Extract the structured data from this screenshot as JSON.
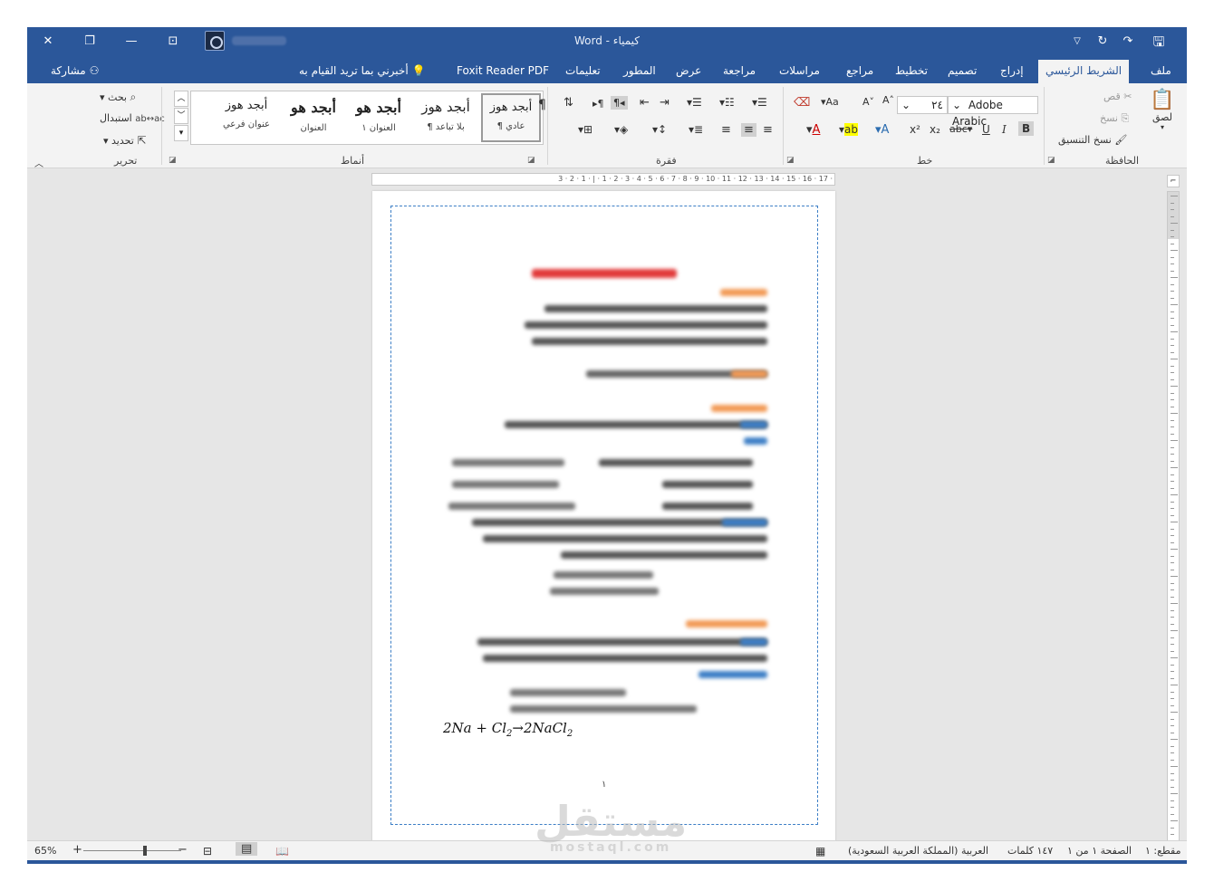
{
  "titlebar": {
    "title": "كيمياء  -  Word",
    "close_icon": "close-icon",
    "restore_icon": "restore-icon",
    "minimize_icon": "minimize-icon",
    "ribbon_display_icon": "ribbon-display-icon",
    "save_icon": "save-icon",
    "undo_icon": "undo-icon",
    "redo_icon": "redo-icon",
    "customize_icon": "customize-qat-icon"
  },
  "tabs": {
    "file": "ملف",
    "home": "الشريط الرئيسي",
    "insert": "إدراج",
    "design": "تصميم",
    "layout": "تخطيط",
    "references": "مراجع",
    "mailings": "مراسلات",
    "review": "مراجعة",
    "view": "عرض",
    "developer": "المطور",
    "help": "تعليمات",
    "foxit": "Foxit Reader PDF",
    "tell_me": "أخبرني بما تريد القيام به",
    "share": "مشاركة"
  },
  "clipboard": {
    "paste": "لصق",
    "cut": "قص",
    "copy": "نسخ",
    "format_painter": "نسخ التنسيق",
    "group": "الحافظة"
  },
  "font": {
    "name": "Adobe Arabic",
    "size": "٢٤",
    "group": "خط",
    "aa": "Aa"
  },
  "paragraph": {
    "group": "فقرة"
  },
  "styles": {
    "group": "أنماط",
    "items": [
      {
        "preview": "أبجد هوز",
        "name": "¶ عادي"
      },
      {
        "preview": "أبجد هوز",
        "name": "¶ بلا تباعد"
      },
      {
        "preview": "أبجد هو",
        "name": "العنوان ١"
      },
      {
        "preview": "أبجد هو",
        "name": "العنوان"
      },
      {
        "preview": "أبجد هوز",
        "name": "عنوان فرعي"
      }
    ]
  },
  "editing": {
    "group": "تحرير",
    "find": "بحث",
    "replace": "استبدال",
    "select": "تحديد"
  },
  "ruler": {
    "numbers": "3 · 2 · 1 · | · 1 · 2 · 3 · 4 · 5 · 6 · 7 · 8 · 9 · 10 · 11 · 12 · 13 · 14 · 15 · 16 · 17 ·"
  },
  "document": {
    "equation": "2Na + Cl₂→2NaCl₂",
    "page_number": "١"
  },
  "statusbar": {
    "section": "مقطع: ١",
    "page": "الصفحة ١ من ١",
    "words": "١٤٧ كلمات",
    "language": "العربية (المملكة العربية السعودية)",
    "zoom": "65%"
  },
  "watermark": {
    "text": "مستقل",
    "sub": "mostaql.com"
  },
  "colors": {
    "accent": "#2b579a",
    "page_border": "#3d7fc6"
  }
}
